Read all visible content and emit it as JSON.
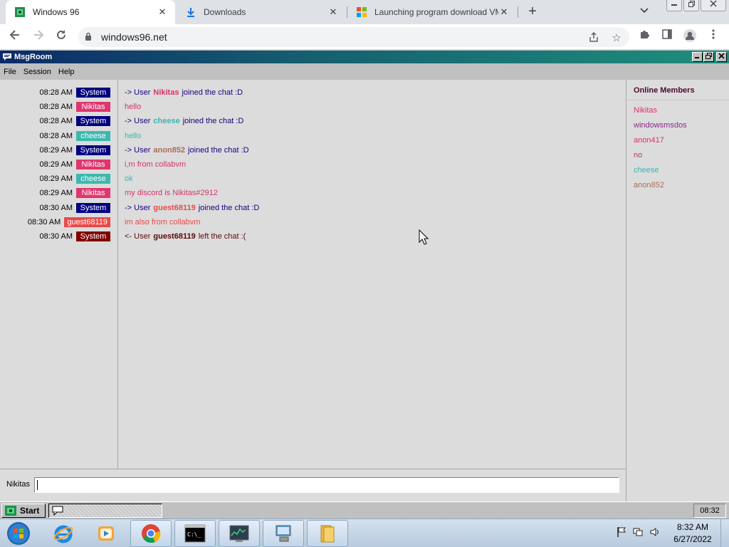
{
  "browser": {
    "tabs": [
      {
        "title": "Windows 96",
        "close": "✕"
      },
      {
        "title": "Downloads",
        "close": "✕"
      },
      {
        "title": "Launching program download VM",
        "close": "✕"
      }
    ],
    "new_tab": "+",
    "url": "windows96.net"
  },
  "app": {
    "title": "MsgRoom",
    "menu": [
      "File",
      "Session",
      "Help"
    ]
  },
  "chat": {
    "messages": [
      {
        "time": "08:28 AM",
        "nick": "System",
        "nick_color": "#000080",
        "kind": "event",
        "pre": "-> User",
        "user": "Nikitas",
        "user_color": "#d6336c",
        "post": "joined the chat :D",
        "text_color": "#1a0080"
      },
      {
        "time": "08:28 AM",
        "nick": "Nikitas",
        "nick_color": "#e0356f",
        "kind": "text",
        "text": "hello",
        "text_color": "#d6336c"
      },
      {
        "time": "08:28 AM",
        "nick": "System",
        "nick_color": "#000080",
        "kind": "event",
        "pre": "-> User",
        "user": "cheese",
        "user_color": "#3bb5b0",
        "post": "joined the chat :D",
        "text_color": "#1a0080"
      },
      {
        "time": "08:28 AM",
        "nick": "cheese",
        "nick_color": "#3cb8b0",
        "kind": "text",
        "text": "hello",
        "text_color": "#3bb5b0"
      },
      {
        "time": "08:29 AM",
        "nick": "System",
        "nick_color": "#000080",
        "kind": "event",
        "pre": "-> User",
        "user": "anon852",
        "user_color": "#a86e58",
        "post": "joined the chat :D",
        "text_color": "#1a0080"
      },
      {
        "time": "08:29 AM",
        "nick": "Nikitas",
        "nick_color": "#e0356f",
        "kind": "text",
        "text": "i,m from collabvm",
        "text_color": "#d6336c"
      },
      {
        "time": "08:29 AM",
        "nick": "cheese",
        "nick_color": "#3cb8b0",
        "kind": "text",
        "text": "ok",
        "text_color": "#3bb5b0"
      },
      {
        "time": "08:29 AM",
        "nick": "Nikitas",
        "nick_color": "#e0356f",
        "kind": "text",
        "text": "my discord is Nikitas#2912",
        "text_color": "#d6336c"
      },
      {
        "time": "08:30 AM",
        "nick": "System",
        "nick_color": "#000080",
        "kind": "event",
        "pre": "-> User",
        "user": "guest68119",
        "user_color": "#e84a4a",
        "post": "joined the chat :D",
        "text_color": "#1a0080"
      },
      {
        "time": "08:30 AM",
        "nick": "guest68119",
        "nick_color": "#e84a4a",
        "kind": "text",
        "text": "im also from collabvm",
        "text_color": "#e84a4a"
      },
      {
        "time": "08:30 AM",
        "nick": "System",
        "nick_color": "#800000",
        "kind": "event",
        "pre": "<- User",
        "user": "guest68119",
        "user_color": "#5a0a0a",
        "post": "left the chat :(",
        "text_color": "#5a0a0a"
      }
    ]
  },
  "members": {
    "title": "Online Members",
    "list": [
      {
        "name": "Nikitas",
        "color": "#d6336c"
      },
      {
        "name": "windowsmsdos",
        "color": "#8a2a8a"
      },
      {
        "name": "anon417",
        "color": "#d6336c"
      },
      {
        "name": "no",
        "color": "#b03a5a"
      },
      {
        "name": "cheese",
        "color": "#3bb5b0"
      },
      {
        "name": "anon852",
        "color": "#a86e58"
      }
    ]
  },
  "composer": {
    "nickname": "Nikitas",
    "value": ""
  },
  "w96_taskbar": {
    "start_label": "Start",
    "clock": "08:32"
  },
  "w7_taskbar": {
    "time": "8:32 AM",
    "date": "6/27/2022"
  }
}
